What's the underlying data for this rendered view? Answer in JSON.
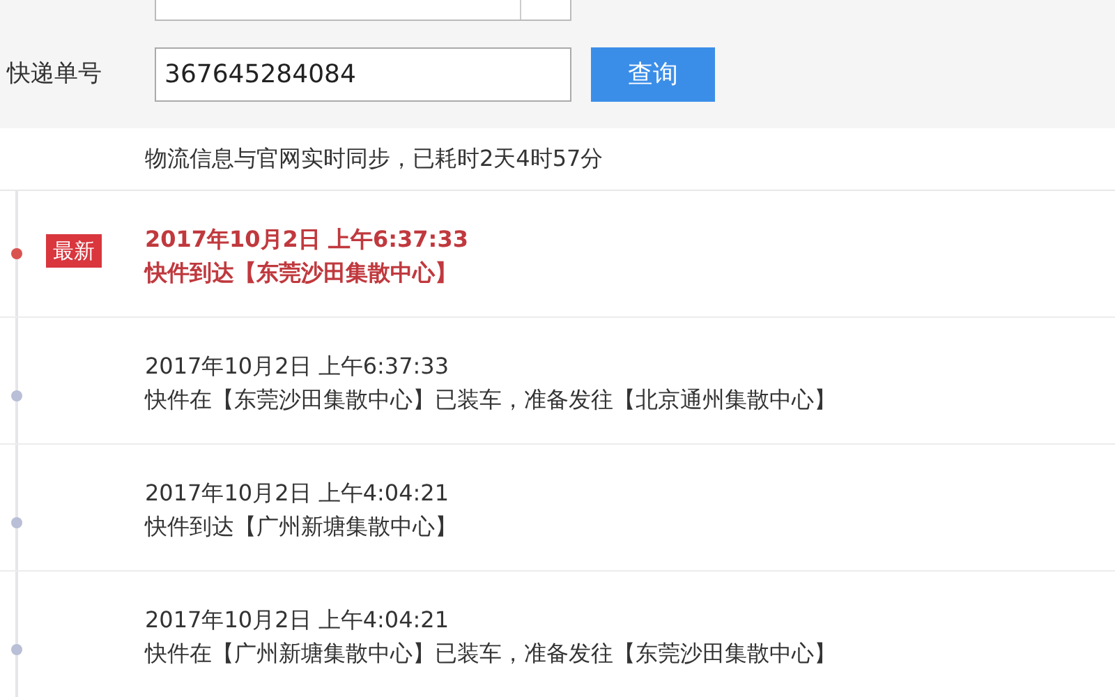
{
  "tracking_form": {
    "tracking_number_label": "快递单号",
    "tracking_number": "367645284084",
    "query_button": "查询"
  },
  "sync_note": "物流信息与官网实时同步，已耗时2天4时57分",
  "timeline": [
    {
      "latest": true,
      "badge": "最新",
      "time": "2017年10月2日 上午6:37:33",
      "description": "快件到达【东莞沙田集散中心】"
    },
    {
      "latest": false,
      "time": "2017年10月2日 上午6:37:33",
      "description": "快件在【东莞沙田集散中心】已装车，准备发往【北京通州集散中心】"
    },
    {
      "latest": false,
      "time": "2017年10月2日 上午4:04:21",
      "description": "快件到达【广州新塘集散中心】"
    },
    {
      "latest": false,
      "time": "2017年10月2日 上午4:04:21",
      "description": "快件在【广州新塘集散中心】已装车，准备发往【东莞沙田集散中心】"
    }
  ]
}
